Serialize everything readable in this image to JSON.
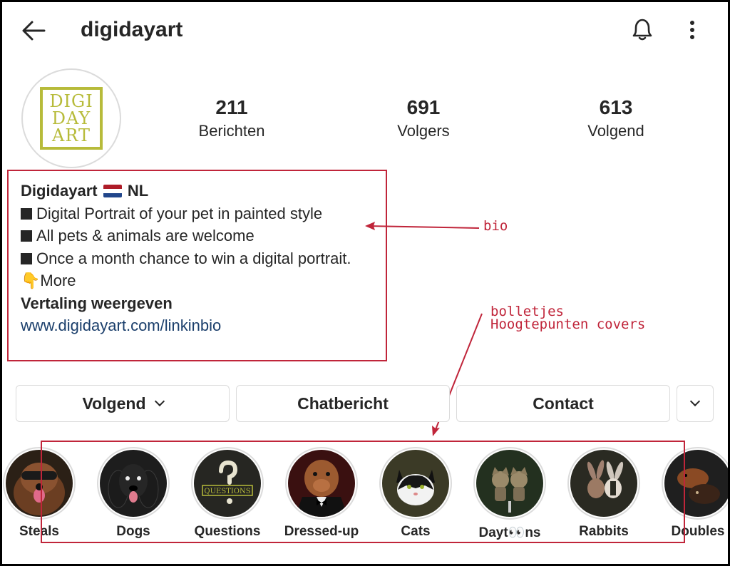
{
  "header": {
    "username": "digidayart",
    "back_icon": "arrow-left-icon",
    "bell_icon": "bell-icon",
    "more_icon": "vertical-dots-icon"
  },
  "avatar": {
    "logo_lines": [
      "DIGI",
      "DAY",
      "ART"
    ],
    "logo_color": "#b7bb3a"
  },
  "stats": [
    {
      "value": "211",
      "label": "Berichten"
    },
    {
      "value": "691",
      "label": "Volgers"
    },
    {
      "value": "613",
      "label": "Volgend"
    }
  ],
  "bio": {
    "name": "Digidayart",
    "country": "NL",
    "flag_colors": [
      "#ae1c28",
      "#ffffff",
      "#21468b"
    ],
    "lines": [
      "Digital Portrait of your pet in painted style",
      "All pets & animals are welcome",
      "Once a month chance to win a digital portrait."
    ],
    "more_emoji": "👇",
    "more_label": "More",
    "translate": "Vertaling weergeven",
    "link": "www.digidayart.com/linkinbio"
  },
  "buttons": {
    "following": "Volgend",
    "message": "Chatbericht",
    "contact": "Contact"
  },
  "highlights": [
    {
      "label": "Steals"
    },
    {
      "label": "Dogs"
    },
    {
      "label": "Questions",
      "cover_text": "QUESTIONS"
    },
    {
      "label": "Dressed-up"
    },
    {
      "label": "Cats"
    },
    {
      "label": "Dayt👀ns"
    },
    {
      "label": "Rabbits"
    },
    {
      "label": "Doubles"
    }
  ],
  "annotations": {
    "bio_note": "bio",
    "highlights_note_1": "bolletjes",
    "highlights_note_2": "Hoogtepunten covers",
    "color": "#c0253a"
  }
}
